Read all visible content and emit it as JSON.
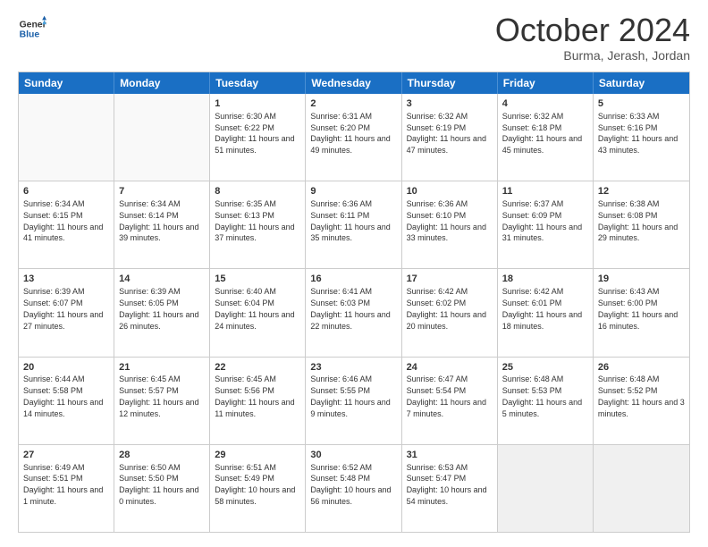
{
  "logo": {
    "line1": "General",
    "line2": "Blue"
  },
  "title": "October 2024",
  "subtitle": "Burma, Jerash, Jordan",
  "header_days": [
    "Sunday",
    "Monday",
    "Tuesday",
    "Wednesday",
    "Thursday",
    "Friday",
    "Saturday"
  ],
  "rows": [
    [
      {
        "day": "",
        "content": ""
      },
      {
        "day": "",
        "content": ""
      },
      {
        "day": "1",
        "content": "Sunrise: 6:30 AM\nSunset: 6:22 PM\nDaylight: 11 hours and 51 minutes."
      },
      {
        "day": "2",
        "content": "Sunrise: 6:31 AM\nSunset: 6:20 PM\nDaylight: 11 hours and 49 minutes."
      },
      {
        "day": "3",
        "content": "Sunrise: 6:32 AM\nSunset: 6:19 PM\nDaylight: 11 hours and 47 minutes."
      },
      {
        "day": "4",
        "content": "Sunrise: 6:32 AM\nSunset: 6:18 PM\nDaylight: 11 hours and 45 minutes."
      },
      {
        "day": "5",
        "content": "Sunrise: 6:33 AM\nSunset: 6:16 PM\nDaylight: 11 hours and 43 minutes."
      }
    ],
    [
      {
        "day": "6",
        "content": "Sunrise: 6:34 AM\nSunset: 6:15 PM\nDaylight: 11 hours and 41 minutes."
      },
      {
        "day": "7",
        "content": "Sunrise: 6:34 AM\nSunset: 6:14 PM\nDaylight: 11 hours and 39 minutes."
      },
      {
        "day": "8",
        "content": "Sunrise: 6:35 AM\nSunset: 6:13 PM\nDaylight: 11 hours and 37 minutes."
      },
      {
        "day": "9",
        "content": "Sunrise: 6:36 AM\nSunset: 6:11 PM\nDaylight: 11 hours and 35 minutes."
      },
      {
        "day": "10",
        "content": "Sunrise: 6:36 AM\nSunset: 6:10 PM\nDaylight: 11 hours and 33 minutes."
      },
      {
        "day": "11",
        "content": "Sunrise: 6:37 AM\nSunset: 6:09 PM\nDaylight: 11 hours and 31 minutes."
      },
      {
        "day": "12",
        "content": "Sunrise: 6:38 AM\nSunset: 6:08 PM\nDaylight: 11 hours and 29 minutes."
      }
    ],
    [
      {
        "day": "13",
        "content": "Sunrise: 6:39 AM\nSunset: 6:07 PM\nDaylight: 11 hours and 27 minutes."
      },
      {
        "day": "14",
        "content": "Sunrise: 6:39 AM\nSunset: 6:05 PM\nDaylight: 11 hours and 26 minutes."
      },
      {
        "day": "15",
        "content": "Sunrise: 6:40 AM\nSunset: 6:04 PM\nDaylight: 11 hours and 24 minutes."
      },
      {
        "day": "16",
        "content": "Sunrise: 6:41 AM\nSunset: 6:03 PM\nDaylight: 11 hours and 22 minutes."
      },
      {
        "day": "17",
        "content": "Sunrise: 6:42 AM\nSunset: 6:02 PM\nDaylight: 11 hours and 20 minutes."
      },
      {
        "day": "18",
        "content": "Sunrise: 6:42 AM\nSunset: 6:01 PM\nDaylight: 11 hours and 18 minutes."
      },
      {
        "day": "19",
        "content": "Sunrise: 6:43 AM\nSunset: 6:00 PM\nDaylight: 11 hours and 16 minutes."
      }
    ],
    [
      {
        "day": "20",
        "content": "Sunrise: 6:44 AM\nSunset: 5:58 PM\nDaylight: 11 hours and 14 minutes."
      },
      {
        "day": "21",
        "content": "Sunrise: 6:45 AM\nSunset: 5:57 PM\nDaylight: 11 hours and 12 minutes."
      },
      {
        "day": "22",
        "content": "Sunrise: 6:45 AM\nSunset: 5:56 PM\nDaylight: 11 hours and 11 minutes."
      },
      {
        "day": "23",
        "content": "Sunrise: 6:46 AM\nSunset: 5:55 PM\nDaylight: 11 hours and 9 minutes."
      },
      {
        "day": "24",
        "content": "Sunrise: 6:47 AM\nSunset: 5:54 PM\nDaylight: 11 hours and 7 minutes."
      },
      {
        "day": "25",
        "content": "Sunrise: 6:48 AM\nSunset: 5:53 PM\nDaylight: 11 hours and 5 minutes."
      },
      {
        "day": "26",
        "content": "Sunrise: 6:48 AM\nSunset: 5:52 PM\nDaylight: 11 hours and 3 minutes."
      }
    ],
    [
      {
        "day": "27",
        "content": "Sunrise: 6:49 AM\nSunset: 5:51 PM\nDaylight: 11 hours and 1 minute."
      },
      {
        "day": "28",
        "content": "Sunrise: 6:50 AM\nSunset: 5:50 PM\nDaylight: 11 hours and 0 minutes."
      },
      {
        "day": "29",
        "content": "Sunrise: 6:51 AM\nSunset: 5:49 PM\nDaylight: 10 hours and 58 minutes."
      },
      {
        "day": "30",
        "content": "Sunrise: 6:52 AM\nSunset: 5:48 PM\nDaylight: 10 hours and 56 minutes."
      },
      {
        "day": "31",
        "content": "Sunrise: 6:53 AM\nSunset: 5:47 PM\nDaylight: 10 hours and 54 minutes."
      },
      {
        "day": "",
        "content": ""
      },
      {
        "day": "",
        "content": ""
      }
    ]
  ]
}
